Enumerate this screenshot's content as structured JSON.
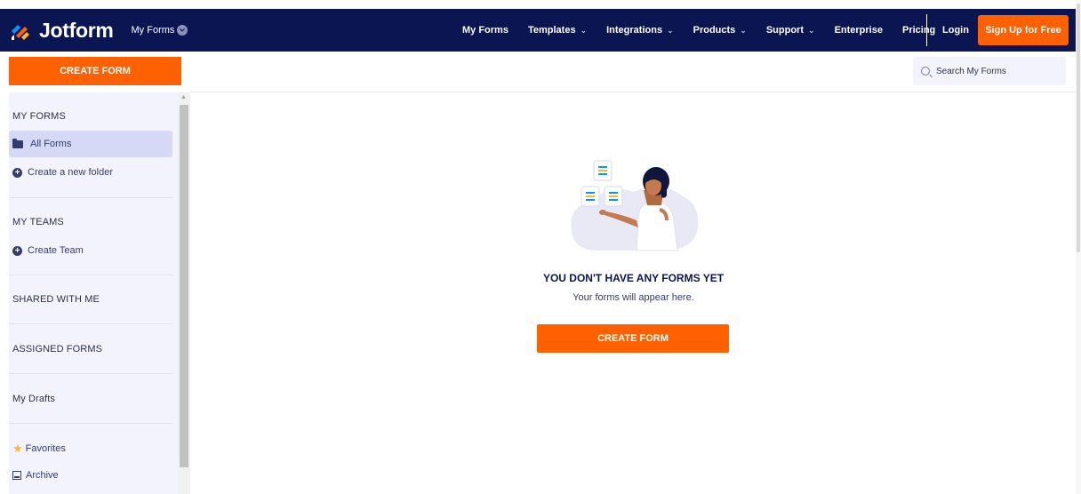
{
  "brand": {
    "name": "Jotform",
    "accent": "#ff6100",
    "navy": "#0a1551"
  },
  "header": {
    "context_menu_label": "My Forms",
    "nav": [
      {
        "label": "My Forms",
        "has_dropdown": false
      },
      {
        "label": "Templates",
        "has_dropdown": true
      },
      {
        "label": "Integrations",
        "has_dropdown": true
      },
      {
        "label": "Products",
        "has_dropdown": true
      },
      {
        "label": "Support",
        "has_dropdown": true
      },
      {
        "label": "Enterprise",
        "has_dropdown": false
      },
      {
        "label": "Pricing",
        "has_dropdown": false
      }
    ],
    "login_label": "Login",
    "signup_label": "Sign Up for Free"
  },
  "sidebar": {
    "create_form_label": "CREATE FORM",
    "my_forms_heading": "MY FORMS",
    "all_forms_label": "All Forms",
    "create_folder_label": "Create a new folder",
    "my_teams_heading": "MY TEAMS",
    "create_team_label": "Create Team",
    "shared_label": "SHARED WITH ME",
    "assigned_label": "ASSIGNED FORMS",
    "drafts_label": "My Drafts",
    "favorites_label": "Favorites",
    "archive_label": "Archive"
  },
  "search": {
    "placeholder": "Search My Forms"
  },
  "empty_state": {
    "title": "YOU DON'T HAVE ANY FORMS YET",
    "subtitle": "Your forms will appear here.",
    "create_form_label": "CREATE FORM"
  },
  "icons": {
    "logo": "jotform-logo-icon",
    "dropdown": "chevron-down-icon",
    "folder": "folder-icon",
    "plus": "plus-circle-icon",
    "star": "star-icon",
    "archive": "archive-icon",
    "search": "search-icon"
  }
}
